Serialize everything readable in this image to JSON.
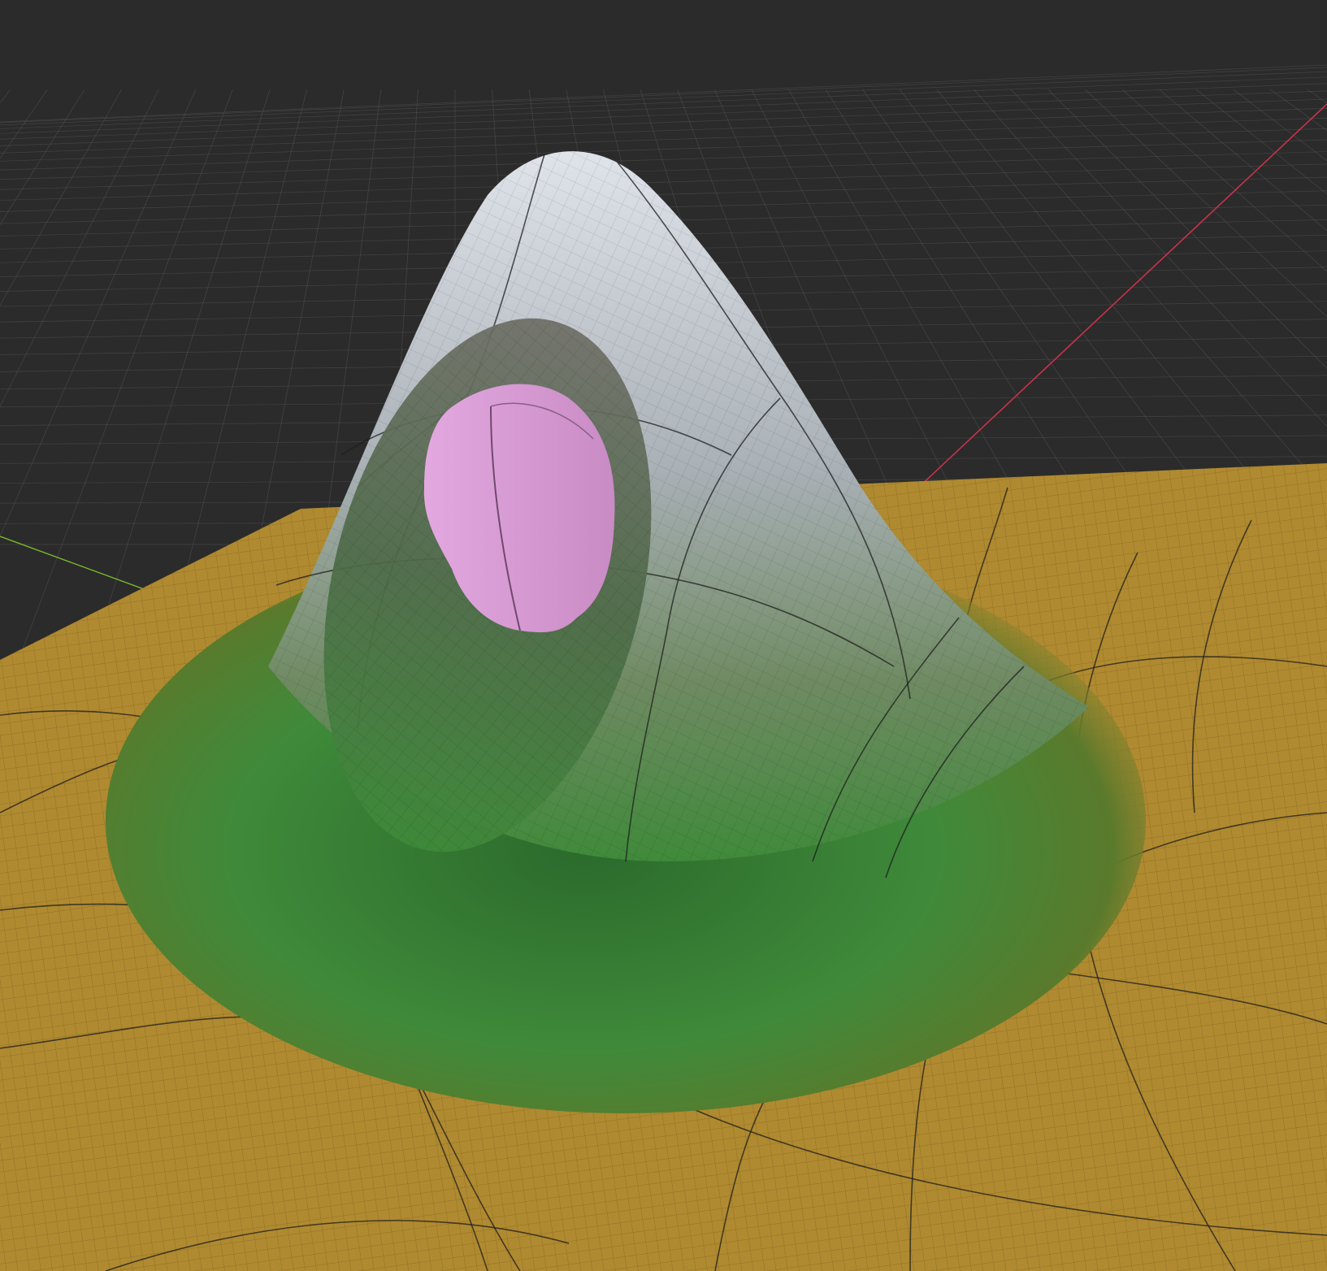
{
  "viewport": {
    "background_color": "#2b2b2b",
    "grid_color": "#5a5a5a",
    "x_axis_color": "#c8324c",
    "y_axis_color": "#7fbf2a"
  },
  "mesh": {
    "shape": "gaussian-bump-with-hole",
    "ground_color": "#b08a30",
    "slope_color": "#3f8a3a",
    "peak_color": "#c9d0d8",
    "wire_color": "#1e1e1e"
  },
  "hole_object": {
    "shape": "ellipsoid",
    "color": "#d79ad6"
  }
}
